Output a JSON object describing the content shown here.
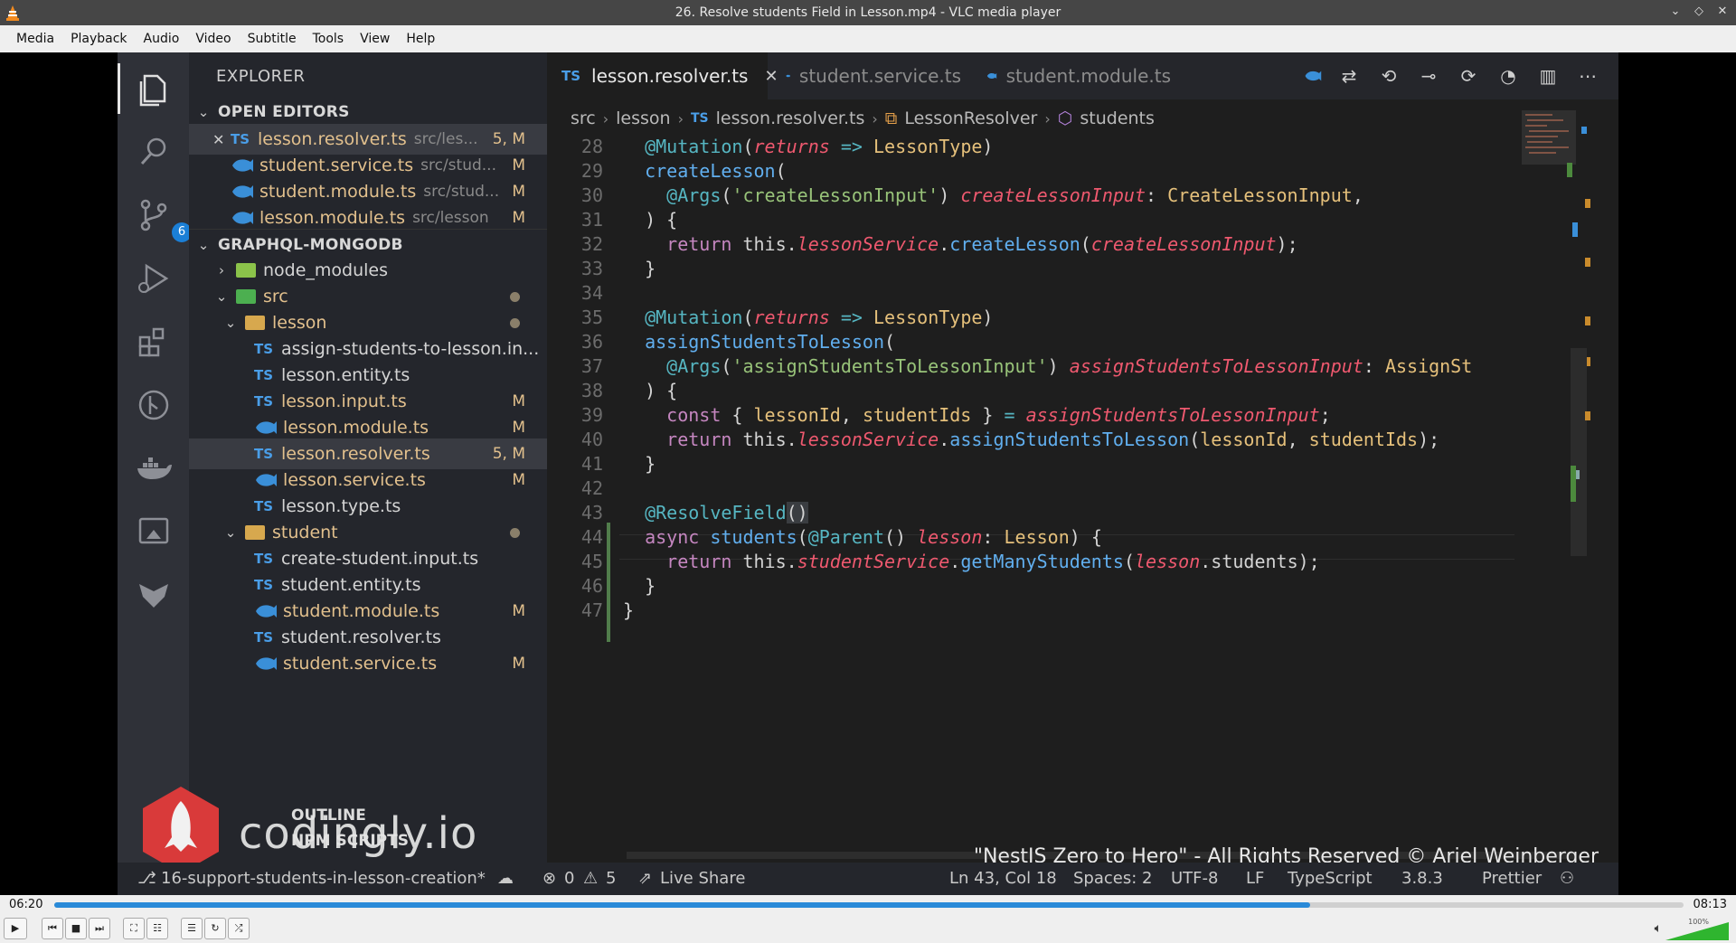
{
  "window": {
    "title": "26. Resolve students Field in Lesson.mp4 - VLC media player"
  },
  "menu": [
    "Media",
    "Playback",
    "Audio",
    "Video",
    "Subtitle",
    "Tools",
    "View",
    "Help"
  ],
  "explorer": {
    "title": "EXPLORER",
    "open_editors_label": "OPEN EDITORS",
    "open_editors": [
      {
        "name": "lesson.resolver.ts",
        "path": "src/les...",
        "status": "5, M",
        "kind": "ts"
      },
      {
        "name": "student.service.ts",
        "path": "src/stud...",
        "status": "M",
        "kind": "nest"
      },
      {
        "name": "student.module.ts",
        "path": "src/stud...",
        "status": "M",
        "kind": "nest"
      },
      {
        "name": "lesson.module.ts",
        "path": "src/lesson",
        "status": "M",
        "kind": "nest"
      }
    ],
    "project_label": "GRAPHQL-MONGODB",
    "tree": {
      "node_modules": "node_modules",
      "src": "src",
      "lesson_folder": "lesson",
      "lesson_files": [
        {
          "name": "assign-students-to-lesson.in...",
          "status": "",
          "kind": "ts"
        },
        {
          "name": "lesson.entity.ts",
          "status": "",
          "kind": "ts"
        },
        {
          "name": "lesson.input.ts",
          "status": "M",
          "kind": "ts"
        },
        {
          "name": "lesson.module.ts",
          "status": "M",
          "kind": "nest"
        },
        {
          "name": "lesson.resolver.ts",
          "status": "5, M",
          "kind": "ts"
        },
        {
          "name": "lesson.service.ts",
          "status": "M",
          "kind": "nest"
        },
        {
          "name": "lesson.type.ts",
          "status": "",
          "kind": "ts"
        }
      ],
      "student_folder": "student",
      "student_files": [
        {
          "name": "create-student.input.ts",
          "status": "",
          "kind": "ts"
        },
        {
          "name": "student.entity.ts",
          "status": "",
          "kind": "ts"
        },
        {
          "name": "student.module.ts",
          "status": "M",
          "kind": "nest"
        },
        {
          "name": "student.resolver.ts",
          "status": "",
          "kind": "ts"
        },
        {
          "name": "student.service.ts",
          "status": "M",
          "kind": "nest"
        }
      ]
    },
    "outline_label": "OUTLINE",
    "npm_label": "NPM SCRIPTS",
    "source_control_badge": "6"
  },
  "brand": "codingly.io",
  "tabs": [
    {
      "label": "lesson.resolver.ts",
      "kind": "ts",
      "active": true
    },
    {
      "label": "student.service.ts",
      "kind": "nest",
      "active": false
    },
    {
      "label": "student.module.ts",
      "kind": "nest",
      "active": false
    }
  ],
  "breadcrumb": [
    "src",
    "lesson",
    "lesson.resolver.ts",
    "LessonResolver",
    "students"
  ],
  "code": {
    "line_numbers": [
      "28",
      "29",
      "30",
      "31",
      "32",
      "33",
      "34",
      "35",
      "36",
      "37",
      "38",
      "39",
      "40",
      "41",
      "42",
      "43",
      "44",
      "45",
      "46",
      "47"
    ]
  },
  "watermark": "\"NestJS Zero to Hero\" - All Rights Reserved © Ariel Weinberger",
  "status": {
    "branch": "16-support-students-in-lesson-creation*",
    "errors": "0",
    "warnings": "5",
    "live_share": "Live Share",
    "position": "Ln 43, Col 18",
    "spaces": "Spaces: 2",
    "encoding": "UTF-8",
    "eol": "LF",
    "language": "TypeScript",
    "version": "3.8.3",
    "formatter": "Prettier"
  },
  "player": {
    "elapsed": "06:20",
    "duration": "08:13",
    "progress": 0.7708,
    "volume_label": "100%",
    "volume": 1.0
  },
  "colors": {
    "accent": "#2a8ad8",
    "ts": "#4a9ee8",
    "modified": "#e2c08d"
  }
}
